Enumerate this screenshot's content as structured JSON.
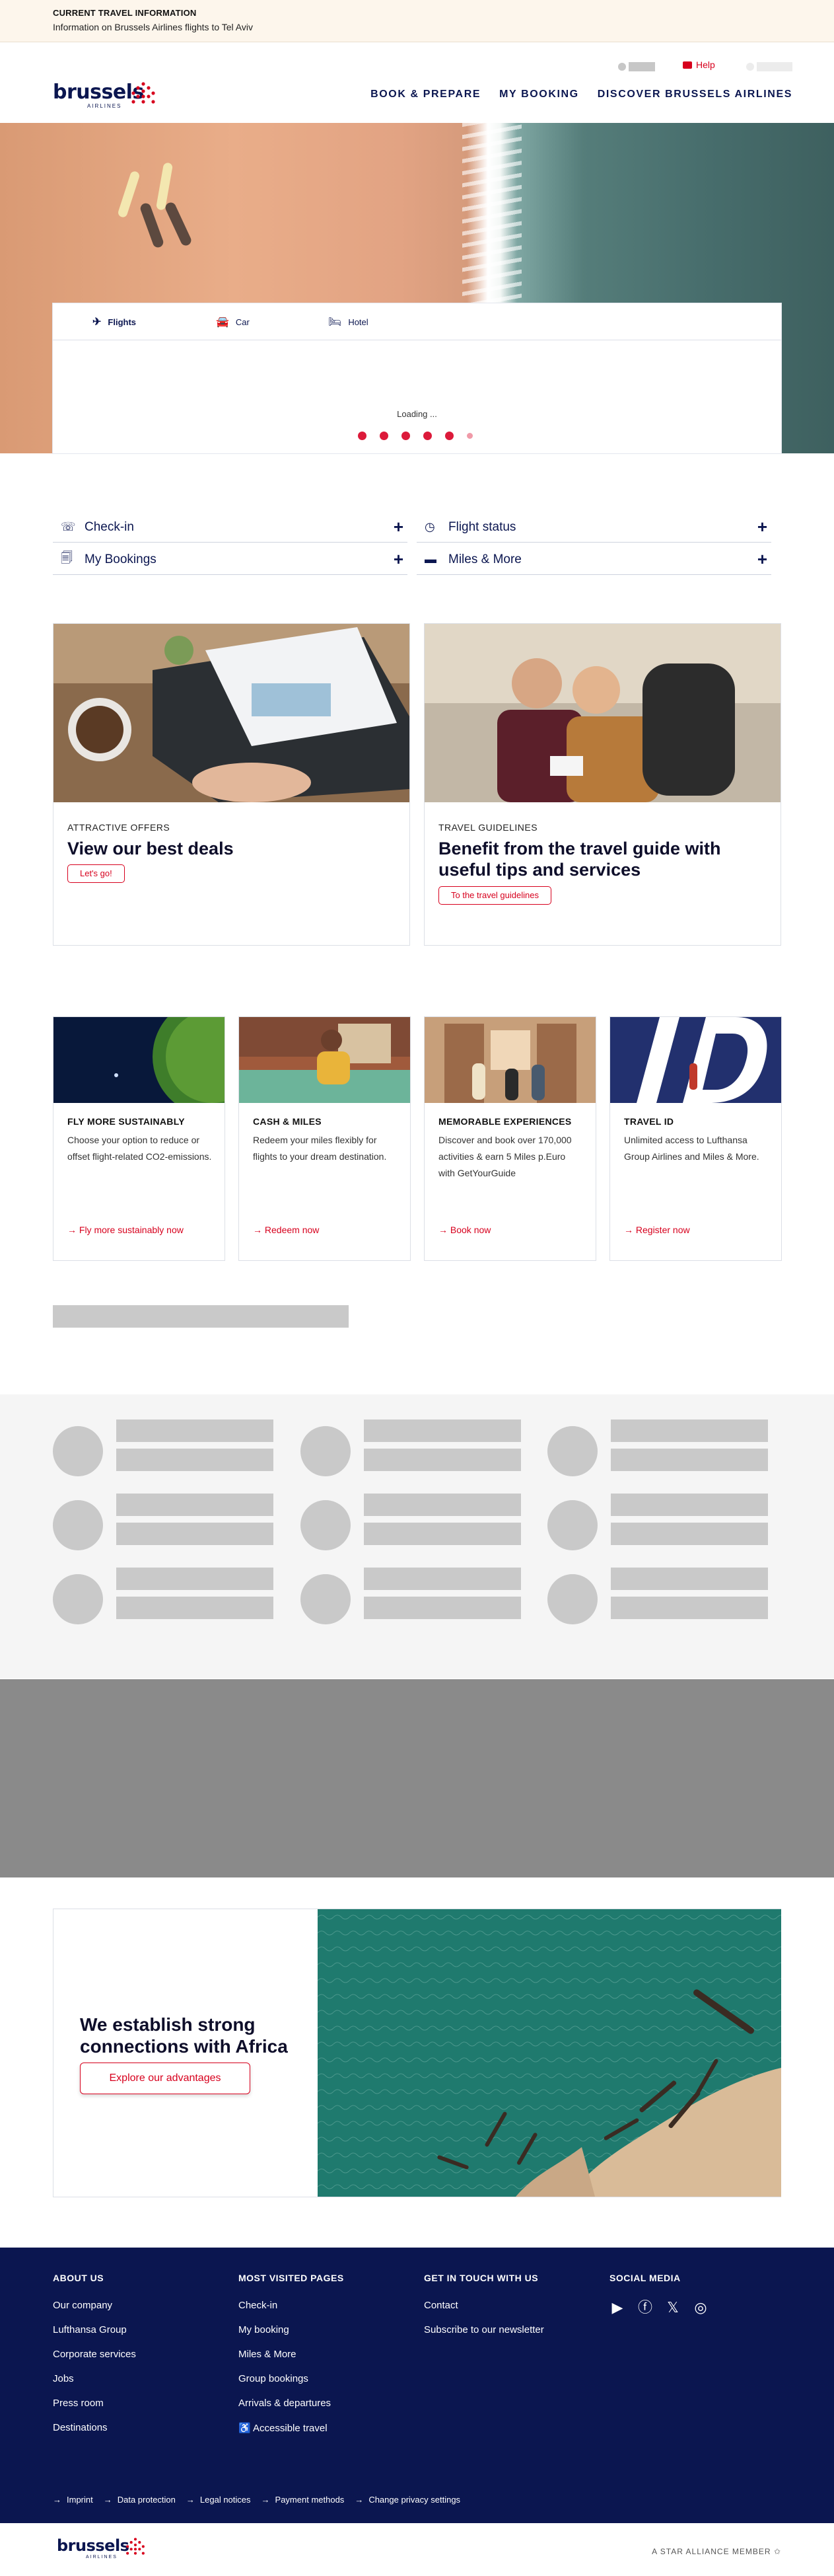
{
  "banner": {
    "title": "CURRENT TRAVEL INFORMATION",
    "text": "Information on Brussels Airlines flights to Tel Aviv"
  },
  "header": {
    "logo_text": "brussels",
    "logo_sub": "AIRLINES",
    "help": "Help",
    "nav": [
      "BOOK & PREPARE",
      "MY BOOKING",
      "DISCOVER BRUSSELS AIRLINES"
    ]
  },
  "widget": {
    "tabs": [
      {
        "label": "Flights",
        "icon": "plane-icon"
      },
      {
        "label": "Car",
        "icon": "car-icon"
      },
      {
        "label": "Hotel",
        "icon": "bed-icon"
      }
    ],
    "loading": "Loading ..."
  },
  "quicklinks": [
    {
      "label": "Check-in",
      "icon": "checkin-icon"
    },
    {
      "label": "Flight status",
      "icon": "clock-icon"
    },
    {
      "label": "My Bookings",
      "icon": "bookings-icon"
    },
    {
      "label": "Miles & More",
      "icon": "card-icon"
    }
  ],
  "bigcards": [
    {
      "eyebrow": "ATTRACTIVE OFFERS",
      "title": "View our best deals",
      "button": "Let's go!"
    },
    {
      "eyebrow": "TRAVEL GUIDELINES",
      "title": "Benefit from the travel guide with useful tips and services",
      "button": "To the travel guidelines"
    }
  ],
  "smcards": [
    {
      "title": "FLY MORE SUSTAINABLY",
      "text": "Choose your option to reduce or offset flight-related CO2-emissions.",
      "link": "Fly more sustainably now"
    },
    {
      "title": "CASH & MILES",
      "text": "Redeem your miles flexibly for flights to your dream destination.",
      "link": "Redeem now"
    },
    {
      "title": "MEMORABLE EXPERIENCES",
      "text": "Discover and book over 170,000 activities & earn 5 Miles p.Euro with GetYourGuide",
      "link": "Book now"
    },
    {
      "title": "TRAVEL ID",
      "text": "Unlimited access to Lufthansa Group Airlines and Miles & More.",
      "link": "Register now"
    }
  ],
  "africa": {
    "heading": "We establish strong connections with Africa",
    "button": "Explore our advantages"
  },
  "footer": {
    "about": {
      "heading": "ABOUT US",
      "items": [
        "Our company",
        "Lufthansa Group",
        "Corporate services",
        "Jobs",
        "Press room",
        "Destinations"
      ]
    },
    "visited": {
      "heading": "MOST VISITED PAGES",
      "items": [
        "Check-in",
        "My booking",
        "Miles & More",
        "Group bookings",
        "Arrivals & departures",
        "Accessible travel"
      ]
    },
    "touch": {
      "heading": "GET IN TOUCH WITH US",
      "items": [
        "Contact",
        "Subscribe to our newsletter"
      ]
    },
    "social": {
      "heading": "SOCIAL MEDIA",
      "icons": [
        "youtube-icon",
        "facebook-icon",
        "x-icon",
        "instagram-icon"
      ]
    },
    "legal": [
      "Imprint",
      "Data protection",
      "Legal notices",
      "Payment methods",
      "Change privacy settings"
    ]
  },
  "bottom": {
    "star": "A STAR ALLIANCE MEMBER"
  },
  "colors": {
    "navy": "#0b1650",
    "red": "#d7001d",
    "skeleton": "#c9c9c9"
  }
}
